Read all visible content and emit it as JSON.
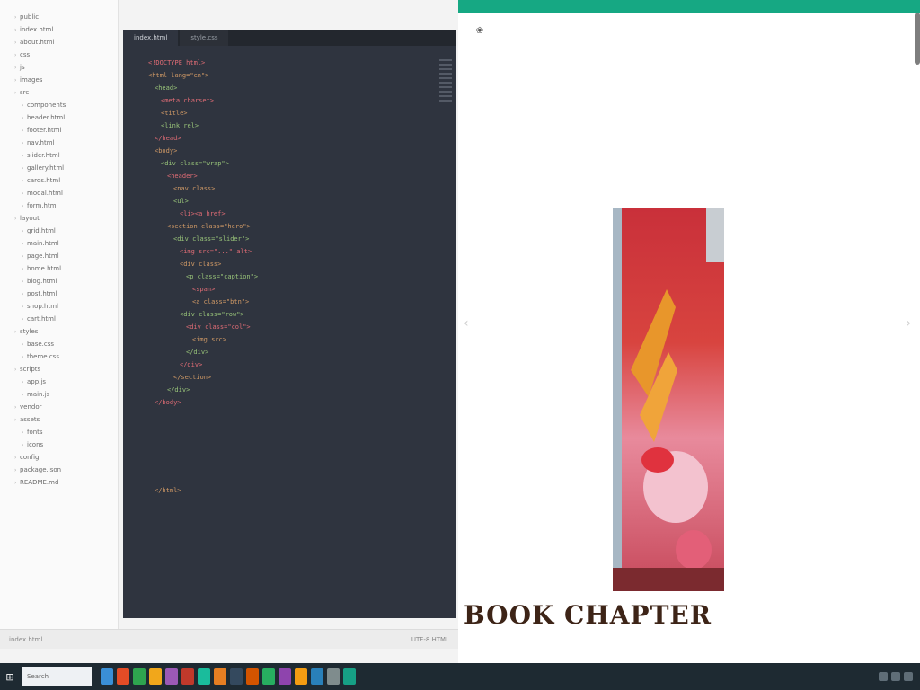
{
  "colors": {
    "preview_topbar": "#16a883",
    "editor_bg": "#2f343f",
    "taskbar_bg": "#1e2a32"
  },
  "tree": {
    "items": [
      "public",
      "index.html",
      "about.html",
      "css",
      "js",
      "images",
      "src",
      "components",
      "header.html",
      "footer.html",
      "nav.html",
      "slider.html",
      "gallery.html",
      "cards.html",
      "modal.html",
      "form.html",
      "layout",
      "grid.html",
      "main.html",
      "page.html",
      "home.html",
      "blog.html",
      "post.html",
      "shop.html",
      "cart.html",
      "styles",
      "base.css",
      "theme.css",
      "scripts",
      "app.js",
      "main.js",
      "vendor",
      "assets",
      "fonts",
      "icons",
      "config",
      "package.json",
      "README.md"
    ]
  },
  "editor": {
    "tabs": [
      "index.html",
      "style.css"
    ],
    "lines": [
      "<!DOCTYPE html>",
      "<html lang=\"en\">",
      "<head>",
      "<meta charset>",
      "<title>",
      "<link rel>",
      "</head>",
      "<body>",
      "<div class=\"wrap\">",
      "<header>",
      "<nav class>",
      "<ul>",
      "<li><a href>",
      "<section class=\"hero\">",
      "<div class=\"slider\">",
      "<img src=\"...\" alt>",
      "<div class>",
      "<p class=\"caption\">",
      "<span>",
      "<a class=\"btn\">",
      "<div class=\"row\">",
      "<div class=\"col\">",
      "<img src>",
      "</div>",
      "</div>",
      "</section>",
      "</div>",
      "</body>",
      "",
      "",
      "",
      "",
      "",
      "",
      "</html>"
    ]
  },
  "statusbar": {
    "left": "index.html",
    "right": "UTF-8  HTML"
  },
  "preview": {
    "brand_icon": "logo-icon",
    "nav_links": [
      "—",
      "—",
      "—",
      "—",
      "—"
    ],
    "hero_caption": "BOOK CHAPTER"
  },
  "taskbar": {
    "search_placeholder": "Search",
    "apps": [
      "#3a8fd6",
      "#e34c26",
      "#2ea44f",
      "#f1a71b",
      "#9b59b6",
      "#c0392b",
      "#1abc9c",
      "#e67e22",
      "#34495e",
      "#d35400",
      "#27ae60",
      "#8e44ad",
      "#f39c12",
      "#2980b9",
      "#7f8c8d",
      "#16a085"
    ]
  }
}
